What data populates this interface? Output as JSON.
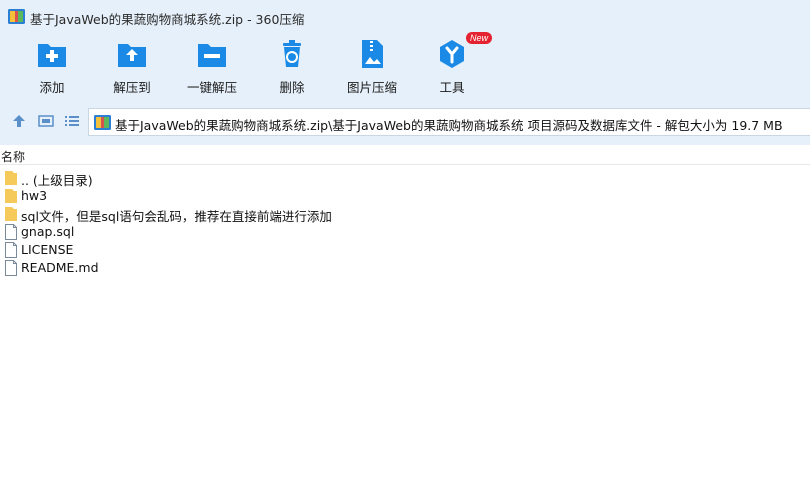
{
  "window": {
    "title": "基于JavaWeb的果蔬购物商城系统.zip - 360压缩"
  },
  "toolbar": {
    "items": [
      {
        "label": "添加",
        "icon": "add-icon"
      },
      {
        "label": "解压到",
        "icon": "extract-to-icon"
      },
      {
        "label": "一键解压",
        "icon": "one-click-extract-icon"
      },
      {
        "label": "删除",
        "icon": "delete-icon"
      },
      {
        "label": "图片压缩",
        "icon": "image-compress-icon"
      },
      {
        "label": "工具",
        "icon": "tools-icon",
        "badge": "New"
      }
    ]
  },
  "nav": {
    "path": "基于JavaWeb的果蔬购物商城系统.zip\\基于JavaWeb的果蔬购物商城系统 项目源码及数据库文件 - 解包大小为 19.7 MB"
  },
  "list": {
    "column_name": "名称",
    "rows": [
      {
        "name": ".. (上级目录)",
        "type": "folder"
      },
      {
        "name": "hw3",
        "type": "folder"
      },
      {
        "name": "sql文件，但是sql语句会乱码，推荐在直接前端进行添加",
        "type": "folder"
      },
      {
        "name": "gnap.sql",
        "type": "file"
      },
      {
        "name": "LICENSE",
        "type": "file"
      },
      {
        "name": "README.md",
        "type": "file"
      }
    ]
  },
  "colors": {
    "toolbar_bg": "#e6f0fa",
    "icon_blue": "#1a8ae6",
    "folder_yellow": "#f5c95a",
    "badge_red": "#e5222f"
  }
}
